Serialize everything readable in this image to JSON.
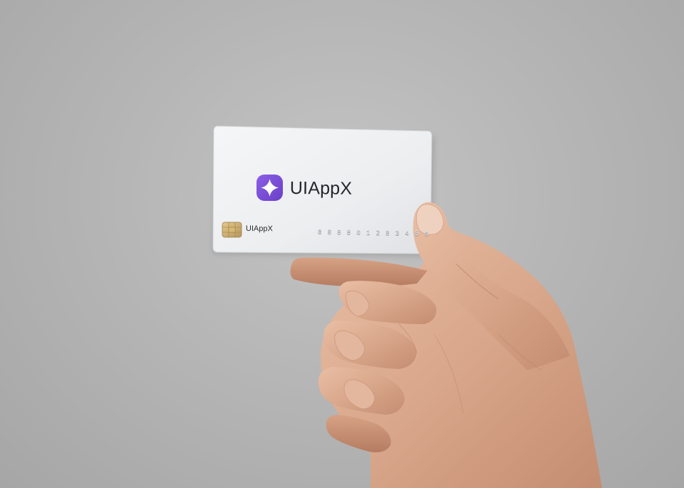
{
  "card": {
    "brand_name": "UIAppX",
    "chip_label": "UIAppX",
    "number_embossed": "8 8 8 8 0 1 2 8 3 4 5 6",
    "logo_icon": "four-point-star-icon",
    "logo_color": "#7a4fd6",
    "card_color": "#eef0f2"
  },
  "scene": {
    "background_color": "#b9b9b9",
    "subject": "hand-holding-card"
  }
}
